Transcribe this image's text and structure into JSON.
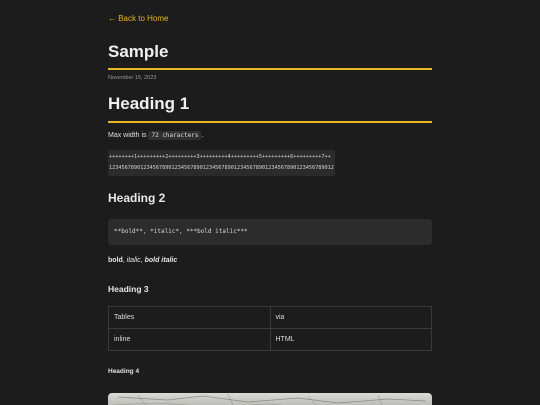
{
  "nav": {
    "back_label": "← Back to Home"
  },
  "post": {
    "title": "Sample",
    "date": "November 15, 2023"
  },
  "section1": {
    "heading": "Heading 1",
    "para_prefix": "Max width is ",
    "para_code": "72 characters",
    "para_suffix": ".",
    "ruler_line1": "++++++++1+++++++++2+++++++++3+++++++++4+++++++++5+++++++++6+++++++++7++",
    "ruler_line2": "123456789012345678901234567890123456789012345678901234567890123456789012"
  },
  "section2": {
    "heading": "Heading 2",
    "code": "**bold**, *italic*, ***bold italic***",
    "bold": "bold",
    "sep1": ", ",
    "italic": "italic",
    "sep2": ", ",
    "bold_italic": "bold italic"
  },
  "section3": {
    "heading": "Heading 3",
    "table": [
      [
        "Tables",
        "via"
      ],
      [
        "inline",
        "HTML"
      ]
    ]
  },
  "section4": {
    "heading": "Heading 4"
  },
  "colors": {
    "background": "#1c1c1c",
    "accent": "#e7b623",
    "text": "#e6e6e6",
    "code_bg": "#2c2c2c"
  },
  "icons": {
    "back": "left-arrow-icon"
  }
}
